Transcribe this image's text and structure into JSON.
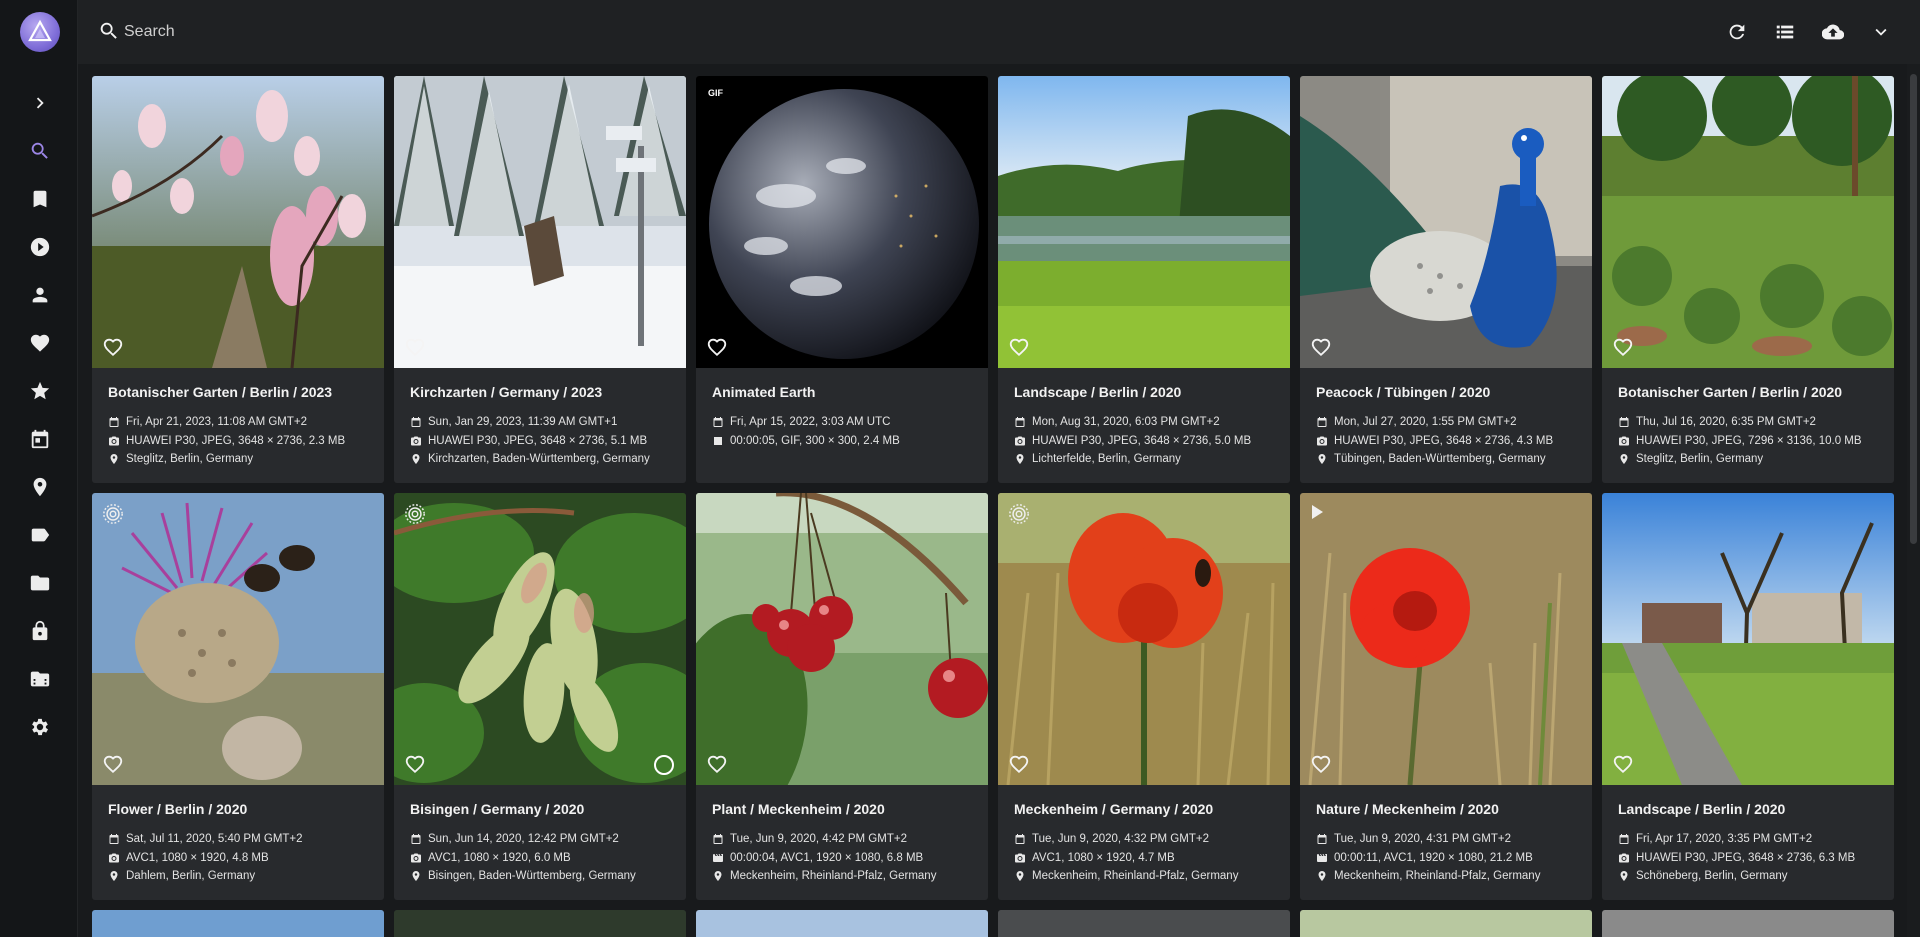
{
  "search": {
    "placeholder": "Search"
  },
  "sidebar": {
    "logo_icon": "photoprism-logo-icon",
    "items": [
      {
        "name": "expand",
        "icon": "chevron-right-icon"
      },
      {
        "name": "search",
        "icon": "search-icon",
        "active": true
      },
      {
        "name": "albums",
        "icon": "bookmark-icon"
      },
      {
        "name": "videos",
        "icon": "play-circle-icon"
      },
      {
        "name": "people",
        "icon": "person-icon"
      },
      {
        "name": "favorites",
        "icon": "heart-icon"
      },
      {
        "name": "moments",
        "icon": "star-icon"
      },
      {
        "name": "calendar",
        "icon": "calendar-icon"
      },
      {
        "name": "places",
        "icon": "map-pin-icon"
      },
      {
        "name": "labels",
        "icon": "label-icon"
      },
      {
        "name": "folders",
        "icon": "folder-icon"
      },
      {
        "name": "private",
        "icon": "lock-icon"
      },
      {
        "name": "library",
        "icon": "film-folder-icon"
      },
      {
        "name": "settings",
        "icon": "gear-icon"
      }
    ]
  },
  "toolbar": {
    "icons": [
      "refresh-icon",
      "view-list-icon",
      "upload-cloud-icon",
      "chevron-down-icon"
    ]
  },
  "cards": [
    {
      "title": "Botanischer Garten / Berlin / 2023",
      "date": "Fri, Apr 21, 2023, 11:08 AM GMT+2",
      "camera": "HUAWEI P30, JPEG, 3648 × 2736, 2.3 MB",
      "location": "Steglitz, Berlin, Germany",
      "type": "photo"
    },
    {
      "title": "Kirchzarten / Germany / 2023",
      "date": "Sun, Jan 29, 2023, 11:39 AM GMT+1",
      "camera": "HUAWEI P30, JPEG, 3648 × 2736, 5.1 MB",
      "location": "Kirchzarten, Baden-Württemberg, Germany",
      "type": "photo"
    },
    {
      "title": "Animated Earth",
      "date": "Fri, Apr 15, 2022, 3:03 AM UTC",
      "camera": "00:00:05, GIF, 300 × 300, 2.4 MB",
      "location": "",
      "type": "gif",
      "badge": "GIF"
    },
    {
      "title": "Landscape / Berlin / 2020",
      "date": "Mon, Aug 31, 2020, 6:03 PM GMT+2",
      "camera": "HUAWEI P30, JPEG, 3648 × 2736, 5.0 MB",
      "location": "Lichterfelde, Berlin, Germany",
      "type": "photo"
    },
    {
      "title": "Peacock / Tübingen / 2020",
      "date": "Mon, Jul 27, 2020, 1:55 PM GMT+2",
      "camera": "HUAWEI P30, JPEG, 3648 × 2736, 4.3 MB",
      "location": "Tübingen, Baden-Württemberg, Germany",
      "type": "photo"
    },
    {
      "title": "Botanischer Garten / Berlin / 2020",
      "date": "Thu, Jul 16, 2020, 6:35 PM GMT+2",
      "camera": "HUAWEI P30, JPEG, 7296 × 3136, 10.0 MB",
      "location": "Steglitz, Berlin, Germany",
      "type": "photo"
    },
    {
      "title": "Flower / Berlin / 2020",
      "date": "Sat, Jul 11, 2020, 5:40 PM GMT+2",
      "camera": "AVC1, 1080 × 1920, 4.8 MB",
      "location": "Dahlem, Berlin, Germany",
      "type": "live"
    },
    {
      "title": "Bisingen / Germany / 2020",
      "date": "Sun, Jun 14, 2020, 12:42 PM GMT+2",
      "camera": "AVC1, 1080 × 1920, 6.0 MB",
      "location": "Bisingen, Baden-Württemberg, Germany",
      "type": "live"
    },
    {
      "title": "Plant / Meckenheim / 2020",
      "date": "Tue, Jun 9, 2020, 4:42 PM GMT+2",
      "camera": "00:00:04, AVC1, 1920 × 1080, 6.8 MB",
      "location": "Meckenheim, Rheinland-Pfalz, Germany",
      "type": "video"
    },
    {
      "title": "Meckenheim / Germany / 2020",
      "date": "Tue, Jun 9, 2020, 4:32 PM GMT+2",
      "camera": "AVC1, 1080 × 1920, 4.7 MB",
      "location": "Meckenheim, Rheinland-Pfalz, Germany",
      "type": "live"
    },
    {
      "title": "Nature / Meckenheim / 2020",
      "date": "Tue, Jun 9, 2020, 4:31 PM GMT+2",
      "camera": "00:00:11, AVC1, 1920 × 1080, 21.2 MB",
      "location": "Meckenheim, Rheinland-Pfalz, Germany",
      "type": "video"
    },
    {
      "title": "Landscape / Berlin / 2020",
      "date": "Fri, Apr 17, 2020, 3:35 PM GMT+2",
      "camera": "HUAWEI P30, JPEG, 3648 × 2736, 6.3 MB",
      "location": "Schöneberg, Berlin, Germany",
      "type": "photo"
    }
  ]
}
